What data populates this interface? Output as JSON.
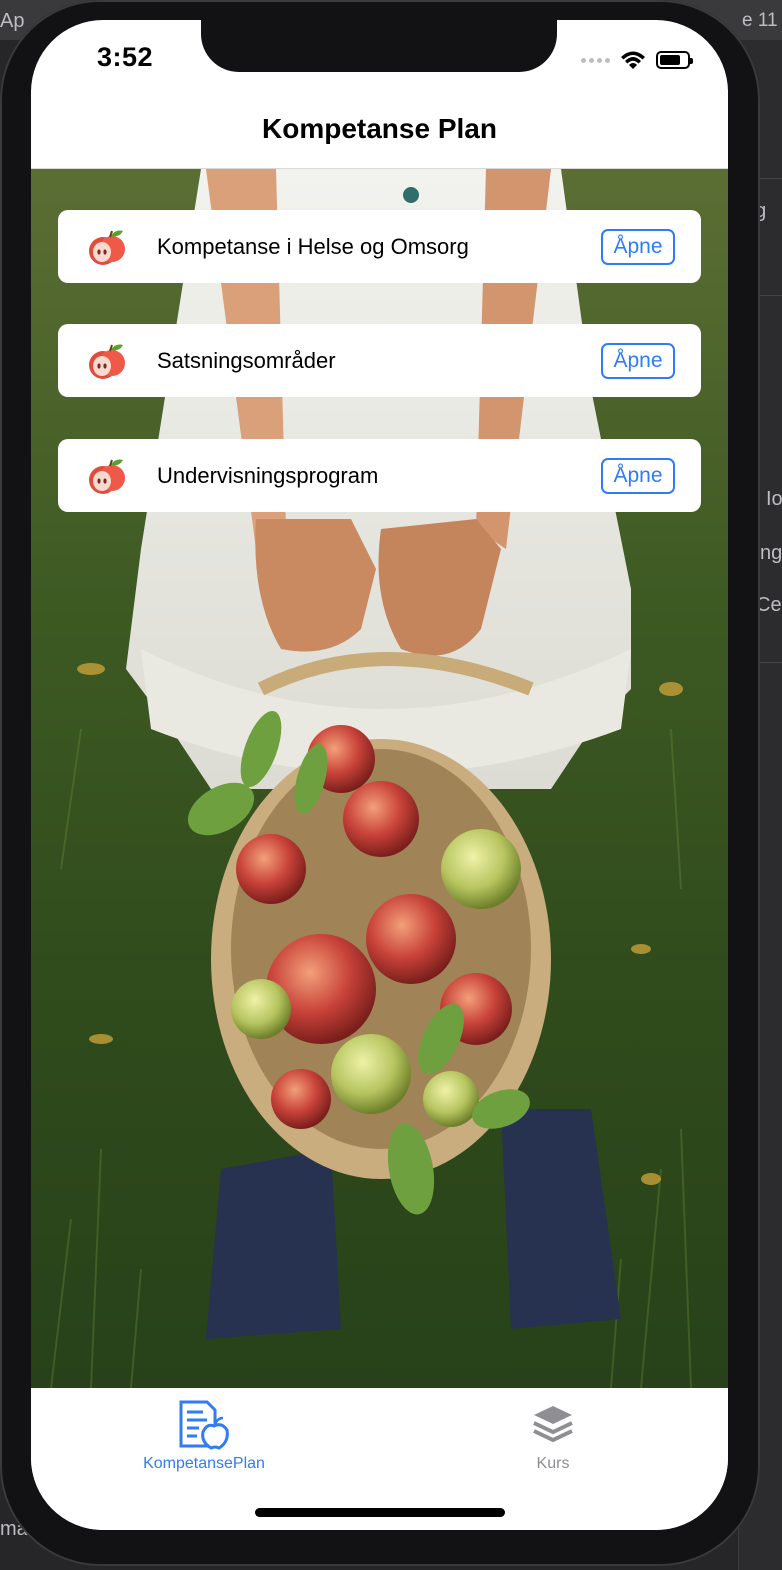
{
  "status_bar": {
    "time": "3:52"
  },
  "nav": {
    "title": "Kompetanse Plan"
  },
  "items": [
    {
      "label": "Kompetanse i Helse og Omsorg",
      "button": "Åpne",
      "icon": "apple-icon"
    },
    {
      "label": "Satsningsområder",
      "button": "Åpne",
      "icon": "apple-icon"
    },
    {
      "label": "Undervisningsprogram",
      "button": "Åpne",
      "icon": "apple-icon"
    }
  ],
  "tabs": [
    {
      "label": "KompetansePlan",
      "icon": "document-apple-icon",
      "active": true
    },
    {
      "label": "Kurs",
      "icon": "layers-icon",
      "active": false
    }
  ],
  "desktop_fragments": [
    "Ap",
    "e 11",
    "ug",
    "Io",
    "ng",
    "Cer",
    "mar"
  ],
  "colors": {
    "accent": "#2f7cf6",
    "inactive_tab": "#8e8e93"
  }
}
